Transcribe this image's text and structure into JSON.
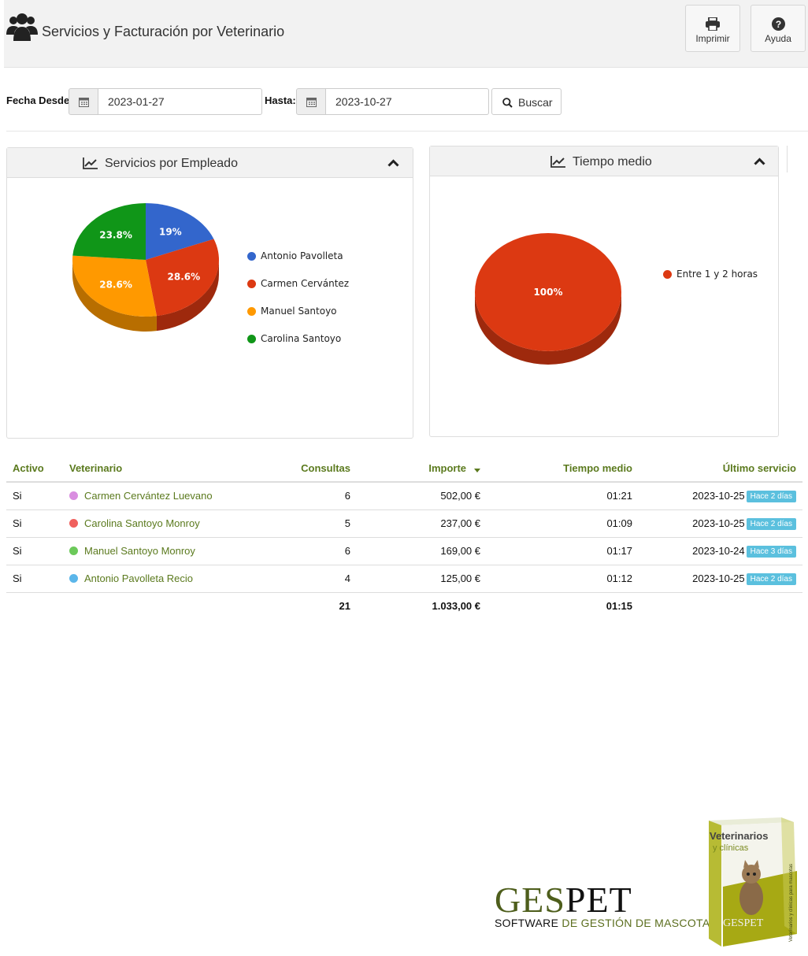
{
  "header": {
    "title": "Servicios y Facturación por Veterinario",
    "print_label": "Imprimir",
    "help_label": "Ayuda"
  },
  "filters": {
    "from_label": "Fecha Desde:",
    "from_value": "2023-01-27",
    "to_label": "Hasta:",
    "to_value": "2023-10-27",
    "search_label": "Buscar"
  },
  "panels": {
    "left_title": "Servicios por Empleado",
    "right_title": "Tiempo medio"
  },
  "chart_data": [
    {
      "type": "pie",
      "title": "Servicios por Empleado",
      "series": [
        {
          "name": "Antonio Pavolleta",
          "value": 19.0,
          "label": "19%",
          "color": "#3366cc"
        },
        {
          "name": "Carmen Cervántez",
          "value": 28.6,
          "label": "28.6%",
          "color": "#dc3912"
        },
        {
          "name": "Manuel Santoyo",
          "value": 28.6,
          "label": "28.6%",
          "color": "#ff9900"
        },
        {
          "name": "Carolina Santoyo",
          "value": 23.8,
          "label": "23.8%",
          "color": "#109618"
        }
      ],
      "legend_position": "right"
    },
    {
      "type": "pie",
      "title": "Tiempo medio",
      "series": [
        {
          "name": "Entre 1 y 2 horas",
          "value": 100,
          "label": "100%",
          "color": "#dc3912"
        }
      ],
      "legend_position": "right"
    }
  ],
  "table": {
    "columns": [
      "Activo",
      "Veterinario",
      "Consultas",
      "Importe",
      "Tiempo medio",
      "Último servicio"
    ],
    "rows": [
      {
        "activo": "Si",
        "name": "Carmen Cervántez Luevano",
        "dot": "#d98ee0",
        "consultas": "6",
        "importe": "502,00 €",
        "tiempo": "01:21",
        "ultimo": "2023-10-25",
        "badge": "Hace 2 días"
      },
      {
        "activo": "Si",
        "name": "Carolina Santoyo Monroy",
        "dot": "#f0605d",
        "consultas": "5",
        "importe": "237,00 €",
        "tiempo": "01:09",
        "ultimo": "2023-10-25",
        "badge": "Hace 2 días"
      },
      {
        "activo": "Si",
        "name": "Manuel Santoyo Monroy",
        "dot": "#6cc95a",
        "consultas": "6",
        "importe": "169,00 €",
        "tiempo": "01:17",
        "ultimo": "2023-10-24",
        "badge": "Hace 3 días"
      },
      {
        "activo": "Si",
        "name": "Antonio Pavolleta Recio",
        "dot": "#5bb6ea",
        "consultas": "4",
        "importe": "125,00 €",
        "tiempo": "01:12",
        "ultimo": "2023-10-25",
        "badge": "Hace 2 días"
      }
    ],
    "totals": {
      "consultas": "21",
      "importe": "1.033,00 €",
      "tiempo": "01:15"
    }
  },
  "branding": {
    "logo_ges": "GES",
    "logo_pet": "PET",
    "tagline_a": "SOFTWARE ",
    "tagline_b": "DE GESTIÓN DE MASCOTAS",
    "box_line1": "Veterinarios",
    "box_line2": "y clínicas",
    "box_side": "Veterinarios y clínicas para mascotas",
    "box_logo": "GESPET"
  },
  "colors": {
    "accent": "#5b7a1e",
    "badge": "#5bc0de"
  }
}
